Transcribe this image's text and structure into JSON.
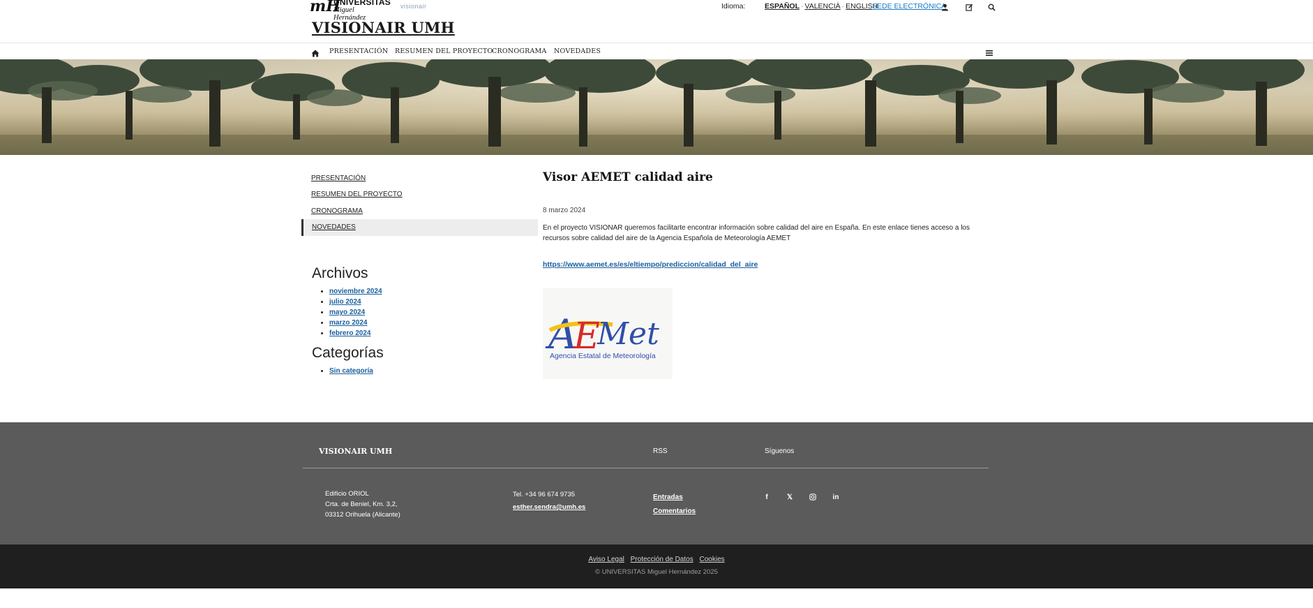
{
  "header": {
    "logo_umh": {
      "mark": "mH",
      "line1": "UNIVERSITAS",
      "line2": "Miguel Hernández"
    },
    "logo_project": "visionair",
    "language_label": "Idioma:",
    "languages": [
      "ESPAÑOL",
      "VALENCIÀ",
      "ENGLISH"
    ],
    "sede_label": "SEDE ELECTRÓNICA",
    "site_title": "VISIONAIR UMH",
    "icons": [
      "user-icon",
      "edit-icon",
      "search-icon"
    ]
  },
  "nav": {
    "items": [
      "PRESENTACIÓN",
      "RESUMEN DEL PROYECTO",
      "CRONOGRAMA",
      "NOVEDADES"
    ]
  },
  "sidebar": {
    "menu": [
      "PRESENTACIÓN",
      "RESUMEN DEL PROYECTO",
      "CRONOGRAMA",
      "NOVEDADES"
    ],
    "active_index": 3,
    "archives_title": "Archivos",
    "archives": [
      "noviembre 2024",
      "julio 2024",
      "mayo 2024",
      "marzo 2024",
      "febrero 2024"
    ],
    "categories_title": "Categorías",
    "categories": [
      "Sin categoría"
    ]
  },
  "post": {
    "title": "Visor AEMET calidad aire",
    "date": "8 marzo 2024",
    "body": "En el proyecto VISIONAR queremos facilitarte encontrar información sobre calidad del aire en España. En este enlace tienes acceso a los recursos sobre calidad del aire de la Agencia Española de Meteorología AEMET",
    "link": "https://www.aemet.es/es/eltiempo/prediccion/calidad_del_aire",
    "image_caption": "Agencia Estatal de Meteorología",
    "image_logo_letters": [
      "A",
      "E",
      "Met"
    ]
  },
  "footer": {
    "title": "VISIONAIR UMH",
    "rss_heading": "RSS",
    "follow_heading": "Síguenos",
    "address": [
      "Edificio ORIOL",
      "Crta. de Beniel, Km. 3,2,",
      "03312 Orihuela (Alicante)"
    ],
    "phone": "Tel. +34 96 674 9735",
    "email": "esther.sendra@umh.es",
    "rss_links": [
      "Entradas",
      "Comentarios"
    ],
    "social": [
      "facebook-icon",
      "x-icon",
      "instagram-icon",
      "linkedin-icon"
    ]
  },
  "bottom": {
    "legal_links": [
      "Aviso Legal",
      "Protección de Datos",
      "Cookies"
    ],
    "copyright": "© UNIVERSITAS Miguel Hernández 2025"
  }
}
